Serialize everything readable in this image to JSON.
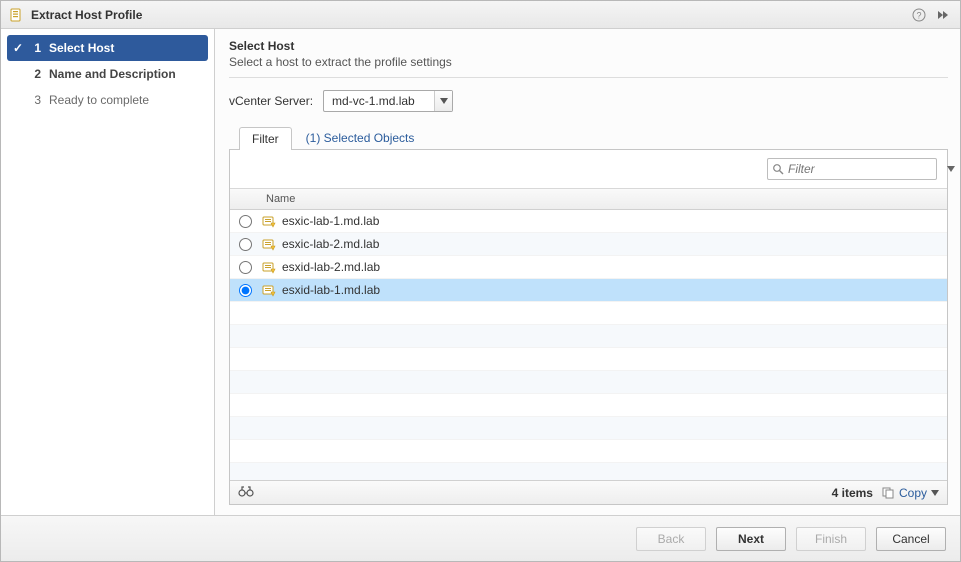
{
  "dialog": {
    "title": "Extract Host Profile"
  },
  "steps": [
    {
      "num": "1",
      "label": "Select Host",
      "state": "active",
      "has_check": true
    },
    {
      "num": "2",
      "label": "Name and Description",
      "state": "pending",
      "has_check": false
    },
    {
      "num": "3",
      "label": "Ready to complete",
      "state": "inactive",
      "has_check": false
    }
  ],
  "main": {
    "title": "Select Host",
    "subtitle": "Select a host to extract the profile settings"
  },
  "vcenter": {
    "label": "vCenter Server:",
    "value": "md-vc-1.md.lab"
  },
  "tabs": {
    "filter": "Filter",
    "selected_objects": "(1) Selected Objects"
  },
  "filter": {
    "placeholder": "Filter"
  },
  "table": {
    "columns": {
      "name": "Name"
    },
    "rows": [
      {
        "name": "esxic-lab-1.md.lab",
        "selected": false
      },
      {
        "name": "esxic-lab-2.md.lab",
        "selected": false
      },
      {
        "name": "esxid-lab-2.md.lab",
        "selected": false
      },
      {
        "name": "esxid-lab-1.md.lab",
        "selected": true
      }
    ],
    "count_label": "4 items",
    "copy_label": "Copy"
  },
  "buttons": {
    "back": "Back",
    "next": "Next",
    "finish": "Finish",
    "cancel": "Cancel"
  }
}
